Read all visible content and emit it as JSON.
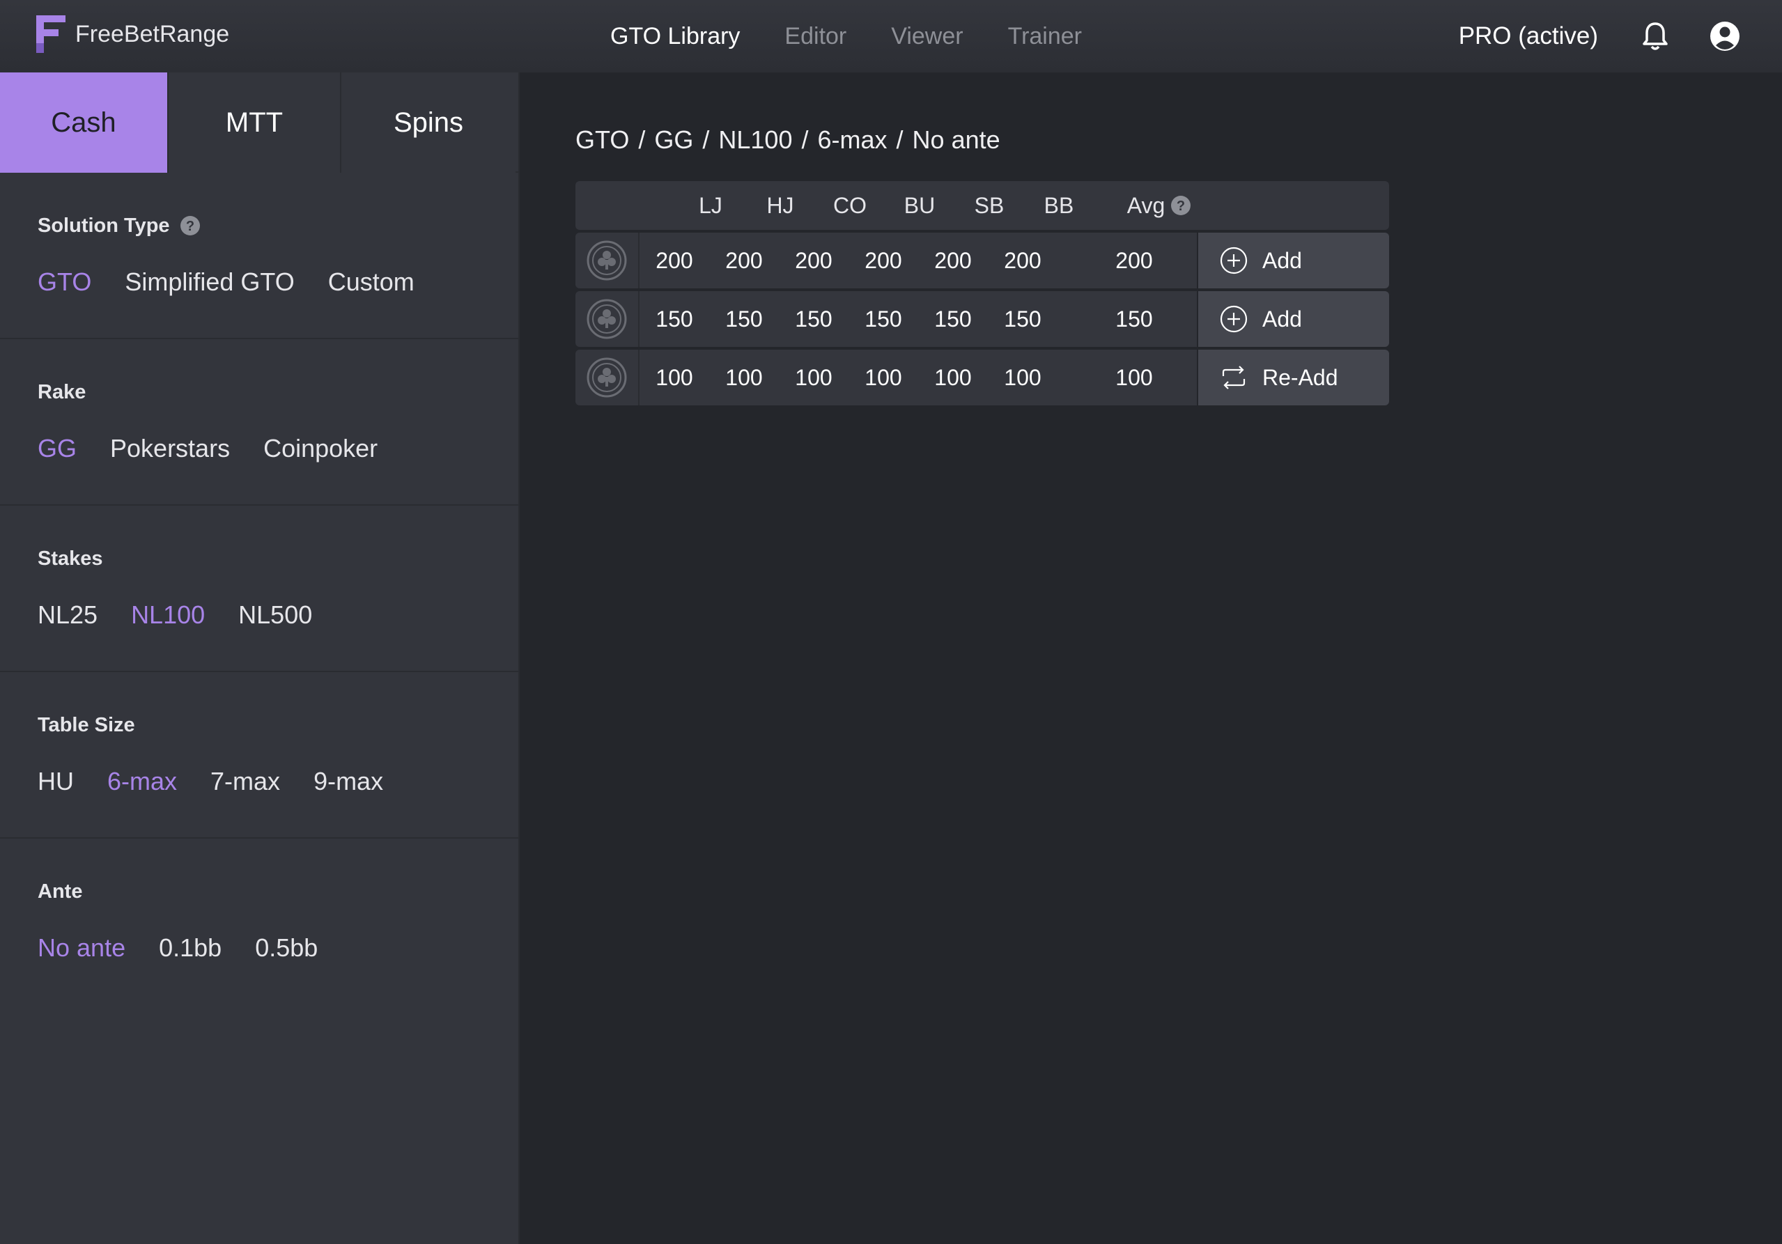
{
  "brand": {
    "name": "FreeBetRange",
    "accent": "#a884e8"
  },
  "nav": {
    "items": [
      {
        "label": "GTO Library",
        "active": true
      },
      {
        "label": "Editor",
        "active": false
      },
      {
        "label": "Viewer",
        "active": false
      },
      {
        "label": "Trainer",
        "active": false
      }
    ],
    "subscription": "PRO (active)"
  },
  "sidebar": {
    "tabs": [
      {
        "label": "Cash",
        "active": true
      },
      {
        "label": "MTT",
        "active": false
      },
      {
        "label": "Spins",
        "active": false
      }
    ],
    "sections": [
      {
        "title": "Solution Type",
        "help": true,
        "options": [
          "GTO",
          "Simplified GTO",
          "Custom"
        ],
        "selected": "GTO"
      },
      {
        "title": "Rake",
        "help": false,
        "options": [
          "GG",
          "Pokerstars",
          "Coinpoker"
        ],
        "selected": "GG"
      },
      {
        "title": "Stakes",
        "help": false,
        "options": [
          "NL25",
          "NL100",
          "NL500"
        ],
        "selected": "NL100"
      },
      {
        "title": "Table Size",
        "help": false,
        "options": [
          "HU",
          "6-max",
          "7-max",
          "9-max"
        ],
        "selected": "6-max"
      },
      {
        "title": "Ante",
        "help": false,
        "options": [
          "No ante",
          "0.1bb",
          "0.5bb"
        ],
        "selected": "No ante"
      }
    ]
  },
  "main": {
    "breadcrumb": [
      "GTO",
      "GG",
      "NL100",
      "6-max",
      "No ante"
    ],
    "table": {
      "columns": [
        "LJ",
        "HJ",
        "CO",
        "BU",
        "SB",
        "BB"
      ],
      "avg_label": "Avg",
      "rows": [
        {
          "values": [
            "200",
            "200",
            "200",
            "200",
            "200",
            "200"
          ],
          "avg": "200",
          "action": "Add",
          "action_icon": "plus-circle-icon"
        },
        {
          "values": [
            "150",
            "150",
            "150",
            "150",
            "150",
            "150"
          ],
          "avg": "150",
          "action": "Add",
          "action_icon": "plus-circle-icon"
        },
        {
          "values": [
            "100",
            "100",
            "100",
            "100",
            "100",
            "100"
          ],
          "avg": "100",
          "action": "Re-Add",
          "action_icon": "repeat-icon"
        }
      ]
    }
  }
}
